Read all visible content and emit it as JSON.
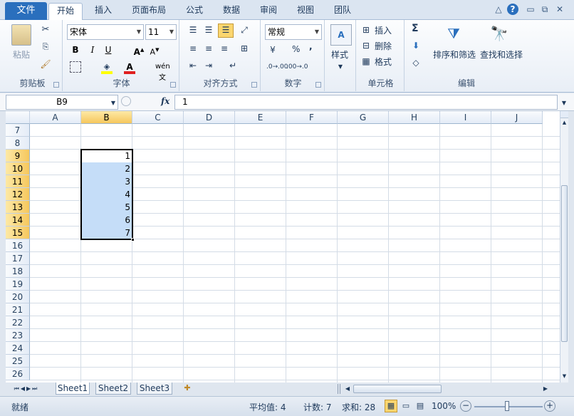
{
  "ribbon_tabs": {
    "file": "文件",
    "home": "开始",
    "insert": "插入",
    "layout": "页面布局",
    "formulas": "公式",
    "data": "数据",
    "review": "审阅",
    "view": "视图",
    "team": "团队"
  },
  "clipboard": {
    "paste": "粘贴",
    "label": "剪贴板"
  },
  "font": {
    "name": "宋体",
    "size": "11",
    "label": "字体"
  },
  "alignment": {
    "label": "对齐方式"
  },
  "number": {
    "format": "常规",
    "percent": "%",
    "comma": ",",
    "label": "数字"
  },
  "styles": {
    "label": "样式"
  },
  "cells": {
    "insert": "插入",
    "delete": "删除",
    "format": "格式",
    "label": "单元格"
  },
  "editing": {
    "sum": "Σ",
    "sort": "排序和筛选",
    "find": "查找和选择",
    "label": "编辑"
  },
  "formula_bar": {
    "name_box": "B9",
    "fx": "fx",
    "value": "1"
  },
  "columns": [
    "A",
    "B",
    "C",
    "D",
    "E",
    "F",
    "G",
    "H",
    "I",
    "J"
  ],
  "rows": [
    "7",
    "8",
    "9",
    "10",
    "11",
    "12",
    "13",
    "14",
    "15",
    "16",
    "17",
    "18",
    "19",
    "20",
    "21",
    "22",
    "23",
    "24",
    "25",
    "26"
  ],
  "cells_data": [
    "1",
    "2",
    "3",
    "4",
    "5",
    "6",
    "7"
  ],
  "sheets": [
    "Sheet1",
    "Sheet2",
    "Sheet3"
  ],
  "status": {
    "ready": "就绪",
    "average": "平均值: 4",
    "count": "计数: 7",
    "sum": "求和: 28",
    "zoom": "100%"
  },
  "colors": {
    "file_tab": "#2a6fbd",
    "selection": "#c5ddf8",
    "header_selected": "#f6c75d"
  }
}
